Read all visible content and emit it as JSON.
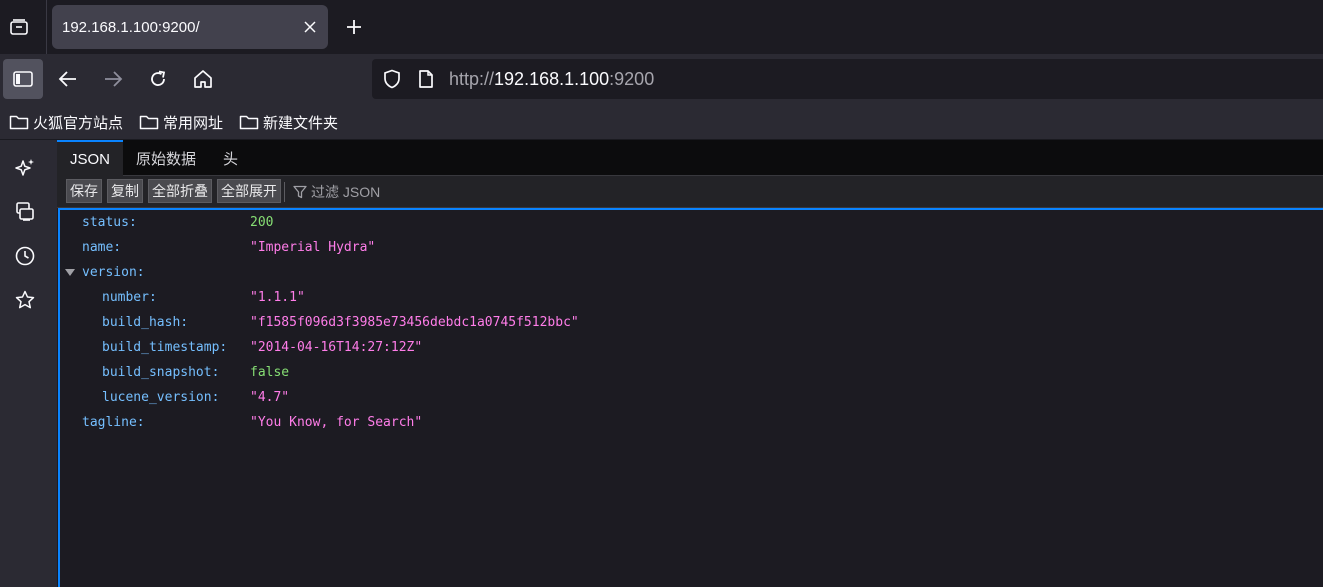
{
  "tab": {
    "title": "192.168.1.100:9200/"
  },
  "url": {
    "scheme": "http://",
    "host": "192.168.1.100",
    "port": ":9200"
  },
  "bookmarks": [
    {
      "label": "火狐官方站点"
    },
    {
      "label": "常用网址"
    },
    {
      "label": "新建文件夹"
    }
  ],
  "viewer": {
    "tabs": [
      {
        "label": "JSON"
      },
      {
        "label": "原始数据"
      },
      {
        "label": "头"
      }
    ],
    "toolbar": {
      "save": "保存",
      "copy": "复制",
      "collapse_all": "全部折叠",
      "expand_all": "全部展开",
      "filter_placeholder": "过滤 JSON"
    }
  },
  "json": {
    "rows": [
      {
        "key": "status:",
        "value": "200"
      },
      {
        "key": "name:",
        "value": "\"Imperial Hydra\""
      },
      {
        "key": "version:",
        "value": ""
      },
      {
        "key": "number:",
        "value": "\"1.1.1\""
      },
      {
        "key": "build_hash:",
        "value": "\"f1585f096d3f3985e73456debdc1a0745f512bbc\""
      },
      {
        "key": "build_timestamp:",
        "value": "\"2014-04-16T14:27:12Z\""
      },
      {
        "key": "build_snapshot:",
        "value": "false"
      },
      {
        "key": "lucene_version:",
        "value": "\"4.7\""
      },
      {
        "key": "tagline:",
        "value": "\"You Know, for Search\""
      }
    ]
  },
  "colors": {
    "accent": "#0a84ff",
    "key": "#75bfff",
    "string": "#ff7de9",
    "number": "#86de74"
  }
}
